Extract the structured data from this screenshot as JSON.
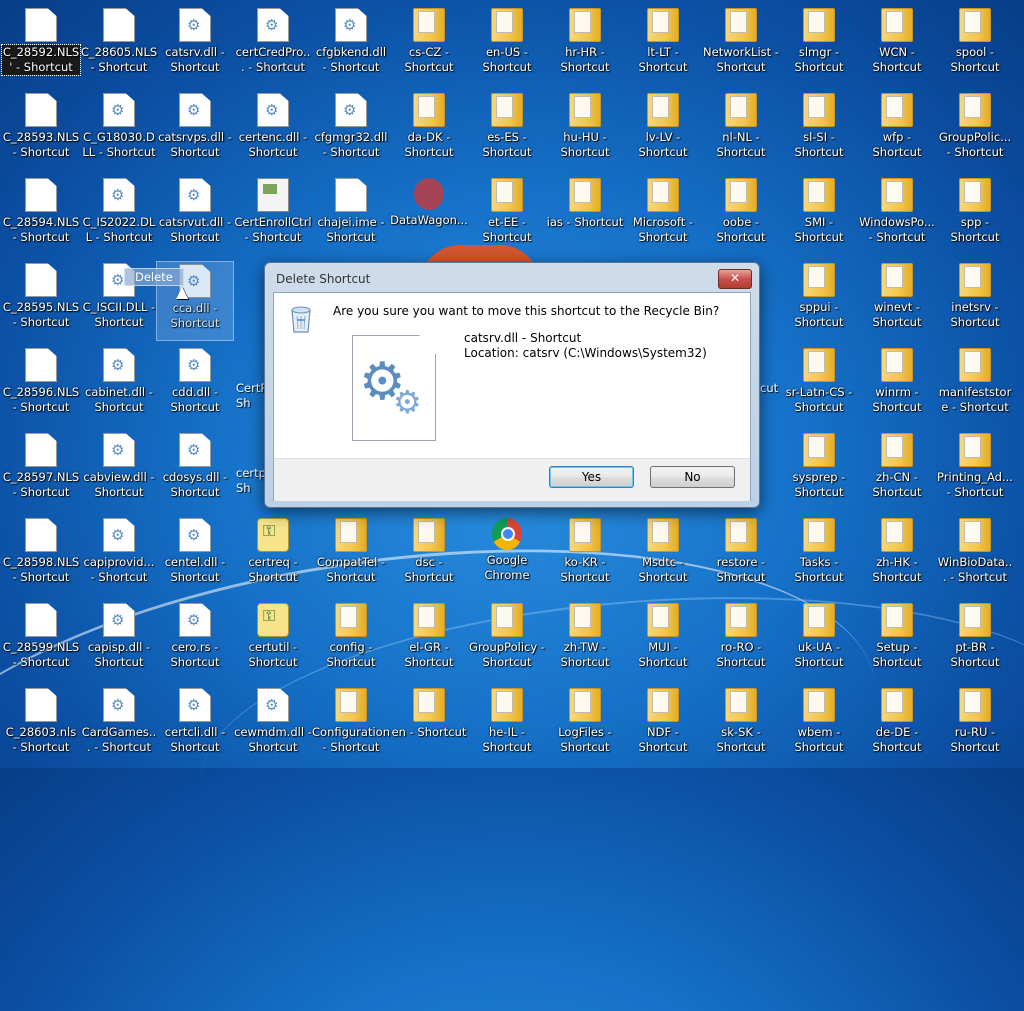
{
  "desktop": {
    "icons": [
      {
        "label": "C_28592.NLS' - Shortcut",
        "type": "file",
        "col": 0,
        "row": 0,
        "selected": true
      },
      {
        "label": "C_28605.NLS - Shortcut",
        "type": "file",
        "col": 1,
        "row": 0
      },
      {
        "label": "catsrv.dll - Shortcut",
        "type": "dll",
        "col": 2,
        "row": 0
      },
      {
        "label": "certCredPro... - Shortcut",
        "type": "dll",
        "col": 3,
        "row": 0
      },
      {
        "label": "cfgbkend.dll - Shortcut",
        "type": "dll",
        "col": 4,
        "row": 0
      },
      {
        "label": "cs-CZ - Shortcut",
        "type": "folder",
        "col": 5,
        "row": 0
      },
      {
        "label": "en-US - Shortcut",
        "type": "folder",
        "col": 6,
        "row": 0
      },
      {
        "label": "hr-HR - Shortcut",
        "type": "folder",
        "col": 7,
        "row": 0
      },
      {
        "label": "lt-LT - Shortcut",
        "type": "folder",
        "col": 8,
        "row": 0
      },
      {
        "label": "NetworkList - Shortcut",
        "type": "folder",
        "col": 9,
        "row": 0
      },
      {
        "label": "slmgr - Shortcut",
        "type": "folder",
        "col": 10,
        "row": 0
      },
      {
        "label": "WCN - Shortcut",
        "type": "folder",
        "col": 11,
        "row": 0
      },
      {
        "label": "spool - Shortcut",
        "type": "folder",
        "col": 12,
        "row": 0
      },
      {
        "label": "C_28593.NLS - Shortcut",
        "type": "file",
        "col": 0,
        "row": 1
      },
      {
        "label": "C_G18030.DLL - Shortcut",
        "type": "dll",
        "col": 1,
        "row": 1
      },
      {
        "label": "catsrvps.dll - Shortcut",
        "type": "dll",
        "col": 2,
        "row": 1
      },
      {
        "label": "certenc.dll - Shortcut",
        "type": "dll",
        "col": 3,
        "row": 1
      },
      {
        "label": "cfgmgr32.dll - Shortcut",
        "type": "dll",
        "col": 4,
        "row": 1
      },
      {
        "label": "da-DK - Shortcut",
        "type": "folder",
        "col": 5,
        "row": 1
      },
      {
        "label": "es-ES - Shortcut",
        "type": "folder",
        "col": 6,
        "row": 1
      },
      {
        "label": "hu-HU - Shortcut",
        "type": "folder",
        "col": 7,
        "row": 1
      },
      {
        "label": "lv-LV - Shortcut",
        "type": "folder",
        "col": 8,
        "row": 1
      },
      {
        "label": "nl-NL - Shortcut",
        "type": "folder",
        "col": 9,
        "row": 1
      },
      {
        "label": "sl-SI - Shortcut",
        "type": "folder",
        "col": 10,
        "row": 1
      },
      {
        "label": "wfp - Shortcut",
        "type": "folder",
        "col": 11,
        "row": 1
      },
      {
        "label": "GroupPolic... - Shortcut",
        "type": "folder",
        "col": 12,
        "row": 1
      },
      {
        "label": "C_28594.NLS - Shortcut",
        "type": "file",
        "col": 0,
        "row": 2
      },
      {
        "label": "C_IS2022.DLL - Shortcut",
        "type": "dll",
        "col": 1,
        "row": 2
      },
      {
        "label": "catsrvut.dll - Shortcut",
        "type": "dll",
        "col": 2,
        "row": 2
      },
      {
        "label": "CertEnrollCtrl - Shortcut",
        "type": "cert",
        "col": 3,
        "row": 2
      },
      {
        "label": "chajei.ime - Shortcut",
        "type": "file",
        "col": 4,
        "row": 2
      },
      {
        "label": "DataWagon...",
        "type": "app",
        "col": 5,
        "row": 2
      },
      {
        "label": "et-EE - Shortcut",
        "type": "folder",
        "col": 6,
        "row": 2
      },
      {
        "label": "ias - Shortcut",
        "type": "folder",
        "col": 7,
        "row": 2
      },
      {
        "label": "Microsoft - Shortcut",
        "type": "folder",
        "col": 8,
        "row": 2
      },
      {
        "label": "oobe - Shortcut",
        "type": "folder",
        "col": 9,
        "row": 2
      },
      {
        "label": "SMI - Shortcut",
        "type": "folder",
        "col": 10,
        "row": 2
      },
      {
        "label": "WindowsPo... - Shortcut",
        "type": "folder",
        "col": 11,
        "row": 2
      },
      {
        "label": "spp - Shortcut",
        "type": "folder",
        "col": 12,
        "row": 2
      },
      {
        "label": "C_28595.NLS - Shortcut",
        "type": "file",
        "col": 0,
        "row": 3
      },
      {
        "label": "C_ISCII.DLL - Shortcut",
        "type": "dll",
        "col": 1,
        "row": 3
      },
      {
        "label": "cca.dll - Shortcut",
        "type": "dll",
        "col": 2,
        "row": 3,
        "dragged": true
      },
      {
        "label": "sppui - Shortcut",
        "type": "folder",
        "col": 10,
        "row": 3
      },
      {
        "label": "winevt - Shortcut",
        "type": "folder",
        "col": 11,
        "row": 3
      },
      {
        "label": "inetsrv - Shortcut",
        "type": "folder",
        "col": 12,
        "row": 3
      },
      {
        "label": "C_28596.NLS - Shortcut",
        "type": "file",
        "col": 0,
        "row": 4
      },
      {
        "label": "cabinet.dll - Shortcut",
        "type": "dll",
        "col": 1,
        "row": 4
      },
      {
        "label": "cdd.dll - Shortcut",
        "type": "dll",
        "col": 2,
        "row": 4
      },
      {
        "label": "sr-Latn-CS - Shortcut",
        "type": "folder",
        "col": 10,
        "row": 4
      },
      {
        "label": "winrm - Shortcut",
        "type": "folder",
        "col": 11,
        "row": 4
      },
      {
        "label": "manifeststore - Shortcut",
        "type": "folder",
        "col": 12,
        "row": 4
      },
      {
        "label": "C_28597.NLS - Shortcut",
        "type": "file",
        "col": 0,
        "row": 5
      },
      {
        "label": "cabview.dll - Shortcut",
        "type": "dll",
        "col": 1,
        "row": 5
      },
      {
        "label": "cdosys.dll - Shortcut",
        "type": "dll",
        "col": 2,
        "row": 5
      },
      {
        "label": "sysprep - Shortcut",
        "type": "folder",
        "col": 10,
        "row": 5
      },
      {
        "label": "zh-CN - Shortcut",
        "type": "folder",
        "col": 11,
        "row": 5
      },
      {
        "label": "Printing_Ad... - Shortcut",
        "type": "folder",
        "col": 12,
        "row": 5
      },
      {
        "label": "C_28598.NLS - Shortcut",
        "type": "file",
        "col": 0,
        "row": 6
      },
      {
        "label": "capiprovid... - Shortcut",
        "type": "dll",
        "col": 1,
        "row": 6
      },
      {
        "label": "centel.dll - Shortcut",
        "type": "dll",
        "col": 2,
        "row": 6
      },
      {
        "label": "certreq - Shortcut",
        "type": "key",
        "col": 3,
        "row": 6
      },
      {
        "label": "CompatTel - Shortcut",
        "type": "folder",
        "col": 4,
        "row": 6
      },
      {
        "label": "dsc - Shortcut",
        "type": "folder",
        "col": 5,
        "row": 6
      },
      {
        "label": "Google Chrome",
        "type": "chrome",
        "col": 6,
        "row": 6
      },
      {
        "label": "ko-KR - Shortcut",
        "type": "folder",
        "col": 7,
        "row": 6
      },
      {
        "label": "Msdtc - Shortcut",
        "type": "folder",
        "col": 8,
        "row": 6
      },
      {
        "label": "restore - Shortcut",
        "type": "folder",
        "col": 9,
        "row": 6
      },
      {
        "label": "Tasks - Shortcut",
        "type": "folder",
        "col": 10,
        "row": 6
      },
      {
        "label": "zh-HK - Shortcut",
        "type": "folder",
        "col": 11,
        "row": 6
      },
      {
        "label": "WinBioData... - Shortcut",
        "type": "folder",
        "col": 12,
        "row": 6
      },
      {
        "label": "C_28599.NLS - Shortcut",
        "type": "file",
        "col": 0,
        "row": 7
      },
      {
        "label": "capisp.dll - Shortcut",
        "type": "dll",
        "col": 1,
        "row": 7
      },
      {
        "label": "cero.rs - Shortcut",
        "type": "dll",
        "col": 2,
        "row": 7
      },
      {
        "label": "certutil - Shortcut",
        "type": "key",
        "col": 3,
        "row": 7
      },
      {
        "label": "config - Shortcut",
        "type": "folder",
        "col": 4,
        "row": 7
      },
      {
        "label": "el-GR - Shortcut",
        "type": "folder",
        "col": 5,
        "row": 7
      },
      {
        "label": "GroupPolicy - Shortcut",
        "type": "folder",
        "col": 6,
        "row": 7
      },
      {
        "label": "zh-TW - Shortcut",
        "type": "folder",
        "col": 7,
        "row": 7
      },
      {
        "label": "MUI - Shortcut",
        "type": "folder",
        "col": 8,
        "row": 7
      },
      {
        "label": "ro-RO - Shortcut",
        "type": "folder",
        "col": 9,
        "row": 7
      },
      {
        "label": "uk-UA - Shortcut",
        "type": "folder",
        "col": 10,
        "row": 7
      },
      {
        "label": "Setup - Shortcut",
        "type": "folder",
        "col": 11,
        "row": 7
      },
      {
        "label": "pt-BR - Shortcut",
        "type": "folder",
        "col": 12,
        "row": 7
      },
      {
        "label": "C_28603.nls - Shortcut",
        "type": "file",
        "col": 0,
        "row": 8
      },
      {
        "label": "CardGames... - Shortcut",
        "type": "dll",
        "col": 1,
        "row": 8
      },
      {
        "label": "certcli.dll - Shortcut",
        "type": "dll",
        "col": 2,
        "row": 8
      },
      {
        "label": "cewmdm.dll - Shortcut",
        "type": "dll",
        "col": 3,
        "row": 8
      },
      {
        "label": "Configuration - Shortcut",
        "type": "folder",
        "col": 4,
        "row": 8
      },
      {
        "label": "en - Shortcut",
        "type": "folder",
        "col": 5,
        "row": 8
      },
      {
        "label": "he-IL - Shortcut",
        "type": "folder",
        "col": 6,
        "row": 8
      },
      {
        "label": "LogFiles - Shortcut",
        "type": "folder",
        "col": 7,
        "row": 8
      },
      {
        "label": "NDF - Shortcut",
        "type": "folder",
        "col": 8,
        "row": 8
      },
      {
        "label": "sk-SK - Shortcut",
        "type": "folder",
        "col": 9,
        "row": 8
      },
      {
        "label": "wbem - Shortcut",
        "type": "folder",
        "col": 10,
        "row": 8
      },
      {
        "label": "de-DE - Shortcut",
        "type": "folder",
        "col": 11,
        "row": 8
      },
      {
        "label": "ru-RU - Shortcut",
        "type": "folder",
        "col": 12,
        "row": 8
      }
    ],
    "partial_labels": [
      {
        "label": "CertP",
        "col": 3,
        "row": 4
      },
      {
        "label": "Sh",
        "col": 3,
        "row": 4,
        "line": 2
      },
      {
        "label": "certp",
        "col": 3,
        "row": 5
      },
      {
        "label": "Sh",
        "col": 3,
        "row": 5,
        "line": 2
      },
      {
        "label": "cut",
        "col": 9,
        "row": 4
      }
    ],
    "drag_tooltip": "Delete"
  },
  "dialog": {
    "title": "Delete Shortcut",
    "close_label": "✕",
    "question": "Are you sure you want to move this shortcut to the Recycle Bin?",
    "file_name": "catsrv.dll - Shortcut",
    "location": "Location: catsrv (C:\\Windows\\System32)",
    "yes_label": "Yes",
    "no_label": "No"
  },
  "colors": {
    "desktop_blue": "#1672c9",
    "close_red": "#c75050",
    "default_button_border": "#3c7fb1"
  }
}
